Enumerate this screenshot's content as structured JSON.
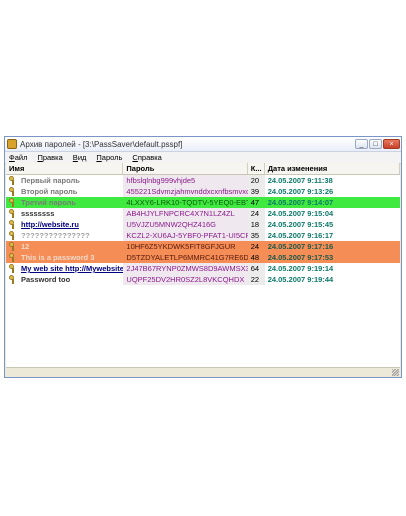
{
  "window": {
    "title": "Архив паролей - [3:\\PassSaver\\default.psspf]",
    "controls": {
      "minimize": "_",
      "maximize": "□",
      "close": "×"
    }
  },
  "menu": [
    "Файл",
    "Правка",
    "Вид",
    "Пароль",
    "Справка"
  ],
  "columns": [
    "Имя",
    "Пароль",
    "К...",
    "Дата изменения"
  ],
  "rows": [
    {
      "name": "Первый пароль",
      "password": "hfbslqlnbg999vhjde5",
      "count": "20",
      "date": "24.05.2007 9:11:38",
      "style": "grey"
    },
    {
      "name": "Второй пароль",
      "password": "455221Sdvmzjahmvnddxcxnfbsmvxcnf...",
      "count": "39",
      "date": "24.05.2007 9:13:26",
      "style": "grey"
    },
    {
      "name": "Третий пароль",
      "password": "4LXXY6-LRK10-TQDTV-5YEQ0-EBTYC...",
      "count": "47",
      "date": "24.05.2007 9:14:07",
      "style": "green"
    },
    {
      "name": "ssssssss",
      "password": "AB4HJYLFNPCRC4X7N1LZ4ZL",
      "count": "24",
      "date": "24.05.2007 9:15:04",
      "style": "dark"
    },
    {
      "name": "http://website.ru",
      "password": "U5VJZU5MNW2QHZ416G",
      "count": "18",
      "date": "24.05.2007 9:15:45",
      "style": "link"
    },
    {
      "name": "???????????????",
      "password": "KCZL2-XU6AJ-5YBF0-PFAT1-UI5CR-C...",
      "count": "35",
      "date": "24.05.2007 9:16:17",
      "style": "muted"
    },
    {
      "name": "12",
      "password": "10HF6Z5YKDWK5FIT8GFJGUR",
      "count": "24",
      "date": "24.05.2007 9:17:16",
      "style": "orange"
    },
    {
      "name": "This is a password 3",
      "password": "D5TZDYALETLP6MMRC41G7RE6DH3...",
      "count": "48",
      "date": "24.05.2007 9:17:53",
      "style": "orange"
    },
    {
      "name": "My web site http://Mywebsite....",
      "password": "2J47B67RYNP0ZMWS8D9AWMSX3W...",
      "count": "64",
      "date": "24.05.2007 9:19:14",
      "style": "link"
    },
    {
      "name": "Password too",
      "password": "UQPF25DV2HR0SZ2L8VKCQHDX",
      "count": "22",
      "date": "24.05.2007 9:19:44",
      "style": "dark"
    }
  ],
  "colors": {
    "green_row": "#3fe93f",
    "orange_row": "#f58d57",
    "password_text": "#8b1a8b",
    "date_text": "#0d7a6a"
  },
  "icons": {
    "app": "key-lock-icon",
    "row": "keys-icon"
  }
}
